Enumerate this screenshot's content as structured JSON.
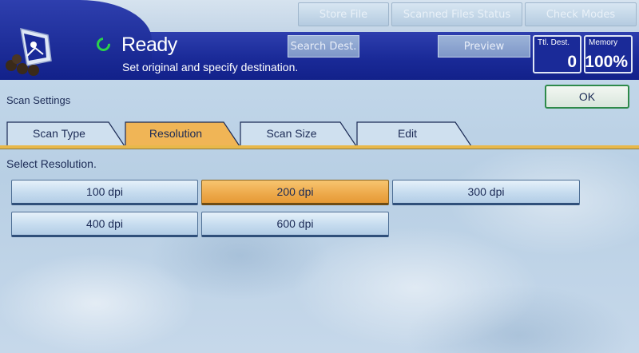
{
  "top_buttons": {
    "store_file": "Store File",
    "scanned_files_status": "Scanned Files Status",
    "check_modes": "Check Modes"
  },
  "header": {
    "status_title": "Ready",
    "status_message": "Set original and specify destination.",
    "search_dest": "Search Dest.",
    "preview": "Preview",
    "ttl_dest_label": "Ttl. Dest.",
    "ttl_dest_value": "0",
    "memory_label": "Memory",
    "memory_value": "100%"
  },
  "settings": {
    "title": "Scan Settings",
    "ok_label": "OK"
  },
  "tabs": [
    {
      "label": "Scan Type",
      "active": false
    },
    {
      "label": "Resolution",
      "active": true
    },
    {
      "label": "Scan Size",
      "active": false
    },
    {
      "label": "Edit",
      "active": false
    }
  ],
  "resolution": {
    "prompt": "Select Resolution.",
    "options": [
      {
        "label": "100 dpi",
        "selected": false
      },
      {
        "label": "200 dpi",
        "selected": true
      },
      {
        "label": "300 dpi",
        "selected": false
      },
      {
        "label": "400 dpi",
        "selected": false
      },
      {
        "label": "600 dpi",
        "selected": false
      }
    ]
  },
  "colors": {
    "header_blue": "#1a2a98",
    "selected_orange": "#eda94a",
    "ready_green": "#2bd14a",
    "ok_border": "#2e8a4a"
  }
}
